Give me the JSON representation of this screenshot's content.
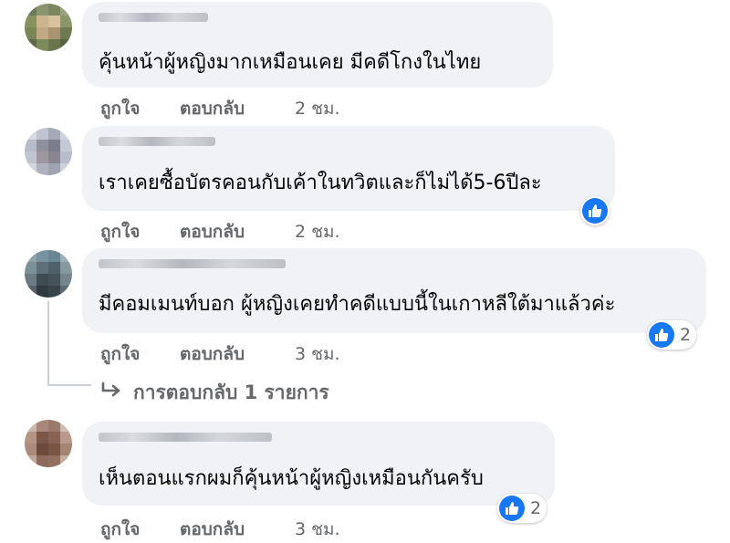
{
  "comments": [
    {
      "text": "คุ้นหน้าผู้หญิงมากเหมือนเคย มีคดีโกงในไทย",
      "like_label": "ถูกใจ",
      "reply_label": "ตอบกลับ",
      "time": "2 ชม.",
      "reaction_count": null
    },
    {
      "text": "เราเคยซื้อบัตรคอนกับเค้าในทวิตและก็ไม่ได้5-6ปีละ",
      "like_label": "ถูกใจ",
      "reply_label": "ตอบกลับ",
      "time": "2 ชม.",
      "reaction_count": null
    },
    {
      "text": "มีคอมเมนท์บอก ผู้หญิงเคยทำคดีแบบนี้ในเกาหลีใต้มาแล้วค่ะ",
      "like_label": "ถูกใจ",
      "reply_label": "ตอบกลับ",
      "time": "3 ชม.",
      "reaction_count": "2"
    },
    {
      "text": "เห็นตอนแรกผมก็คุ้นหน้าผู้หญิงเหมือนกันครับ",
      "like_label": "ถูกใจ",
      "reply_label": "ตอบกลับ",
      "time": "3 ชม.",
      "reaction_count": "2"
    }
  ],
  "reply_toggle": {
    "icon": "reply-arrow-icon",
    "label": "การตอบกลับ 1 รายการ"
  },
  "colors": {
    "bubble": "#f0f2f5",
    "text": "#050505",
    "secondary": "#65676b",
    "like_blue": "#1877f2"
  }
}
